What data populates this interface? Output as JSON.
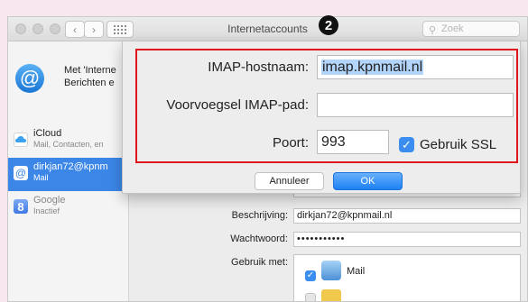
{
  "window": {
    "title": "Internetaccounts",
    "search_placeholder": "Zoek",
    "step_marker": "2"
  },
  "sidebar": {
    "intro_line1": "Met 'Interne",
    "intro_line2": "Berichten e",
    "accounts": [
      {
        "name": "iCloud",
        "sub": "Mail, Contacten, en",
        "icon": "icloud-icon",
        "selected": false
      },
      {
        "name": "dirkjan72@kpnm",
        "sub": "Mail",
        "icon": "at-icon",
        "selected": true
      },
      {
        "name": "Google",
        "sub": "Inactief",
        "icon": "google-icon",
        "selected": false
      }
    ]
  },
  "details": {
    "description_label": "Beschrijving:",
    "description_value": "dirkjan72@kpnmail.nl",
    "password_label": "Wachtwoord:",
    "password_value": "•••••••••••",
    "use_with_label": "Gebruik met:",
    "use_with_app": "Mail"
  },
  "sheet": {
    "host_label": "IMAP-hostnaam:",
    "host_value": "imap.kpnmail.nl",
    "prefix_label": "Voorvoegsel IMAP-pad:",
    "prefix_value": "",
    "port_label": "Poort:",
    "port_value": "993",
    "ssl_label": "Gebruik SSL",
    "ssl_checked": true,
    "cancel_label": "Annuleer",
    "ok_label": "OK"
  },
  "colors": {
    "accent": "#3b86e7",
    "highlight_box": "#e0161e"
  }
}
